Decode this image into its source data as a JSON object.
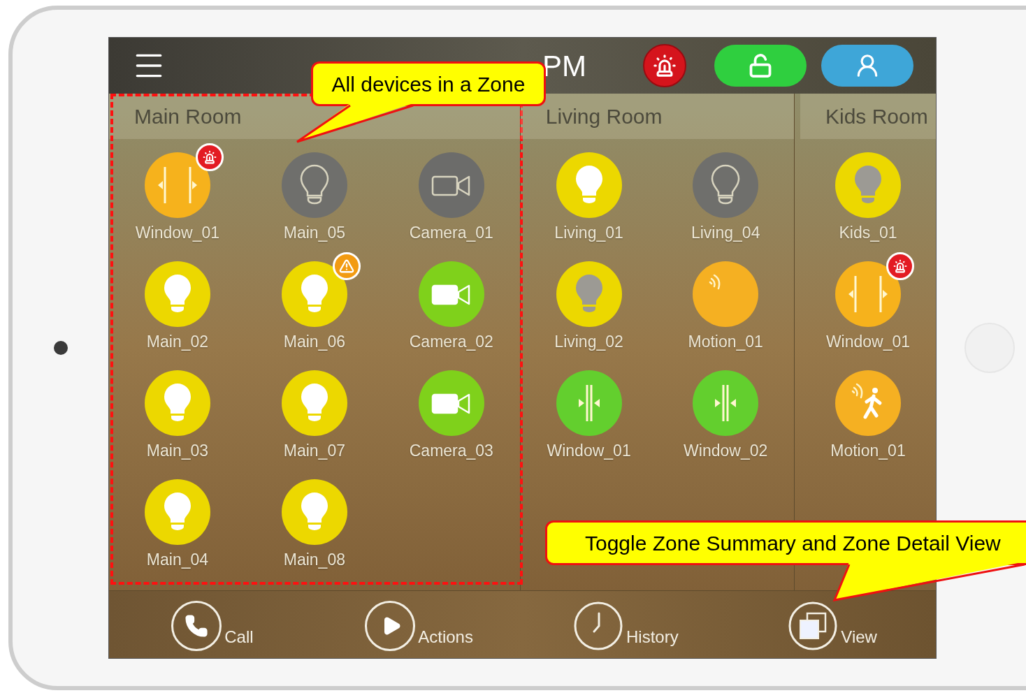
{
  "top_bar": {
    "time": "PM"
  },
  "zones": [
    {
      "name": "Main Room",
      "outlined": true,
      "devices": [
        {
          "name": "Window_01",
          "kind": "window",
          "active": true,
          "alarm": true,
          "warning": false
        },
        {
          "name": "Main_05",
          "kind": "light",
          "active": false,
          "dimmed": false,
          "alarm": false,
          "warning": false
        },
        {
          "name": "Camera_01",
          "kind": "camera",
          "active": false,
          "alarm": false,
          "warning": false
        },
        {
          "name": "Main_02",
          "kind": "light",
          "active": true,
          "dimmed": false,
          "alarm": false,
          "warning": false
        },
        {
          "name": "Main_06",
          "kind": "light",
          "active": true,
          "dimmed": false,
          "alarm": false,
          "warning": true
        },
        {
          "name": "Camera_02",
          "kind": "camera",
          "active": true,
          "alarm": false,
          "warning": false
        },
        {
          "name": "Main_03",
          "kind": "light",
          "active": true,
          "dimmed": false,
          "alarm": false,
          "warning": false
        },
        {
          "name": "Main_07",
          "kind": "light",
          "active": true,
          "dimmed": false,
          "alarm": false,
          "warning": false
        },
        {
          "name": "Camera_03",
          "kind": "camera",
          "active": true,
          "alarm": false,
          "warning": false
        },
        {
          "name": "Main_04",
          "kind": "light",
          "active": true,
          "dimmed": false,
          "alarm": false,
          "warning": false
        },
        {
          "name": "Main_08",
          "kind": "light",
          "active": true,
          "dimmed": false,
          "alarm": false,
          "warning": false
        }
      ]
    },
    {
      "name": "Living Room",
      "outlined": false,
      "devices": [
        {
          "name": "Living_01",
          "kind": "light",
          "active": true,
          "dimmed": false,
          "alarm": false,
          "warning": false
        },
        {
          "name": "Living_04",
          "kind": "light",
          "active": false,
          "dimmed": false,
          "alarm": false,
          "warning": false
        },
        {
          "name": "Living_02",
          "kind": "light",
          "active": true,
          "dimmed": true,
          "alarm": false,
          "warning": false
        },
        {
          "name": "Motion_01",
          "kind": "motion",
          "active": false,
          "alarm": false,
          "warning": false
        },
        {
          "name": "Window_01",
          "kind": "window",
          "active": false,
          "alarm": false,
          "warning": false
        },
        {
          "name": "Window_02",
          "kind": "window",
          "active": false,
          "alarm": false,
          "warning": false
        }
      ]
    },
    {
      "name": "Kids Room",
      "outlined": false,
      "devices": [
        {
          "name": "Kids_01",
          "kind": "light",
          "active": true,
          "dimmed": true,
          "alarm": false,
          "warning": false
        },
        {
          "name": "Window_01",
          "kind": "window",
          "active": true,
          "alarm": true,
          "warning": false
        },
        {
          "name": "Motion_01",
          "kind": "motion",
          "active": true,
          "alarm": false,
          "warning": false
        }
      ]
    }
  ],
  "bottom_nav": [
    {
      "label": "Call",
      "kind": "call"
    },
    {
      "label": "Actions",
      "kind": "actions"
    },
    {
      "label": "History",
      "kind": "history"
    },
    {
      "label": "View",
      "kind": "view"
    }
  ],
  "callouts": [
    {
      "text": "All devices in a Zone",
      "kind": "top"
    },
    {
      "text": "Toggle Zone Summary and Zone Detail View",
      "kind": "bottom"
    }
  ]
}
